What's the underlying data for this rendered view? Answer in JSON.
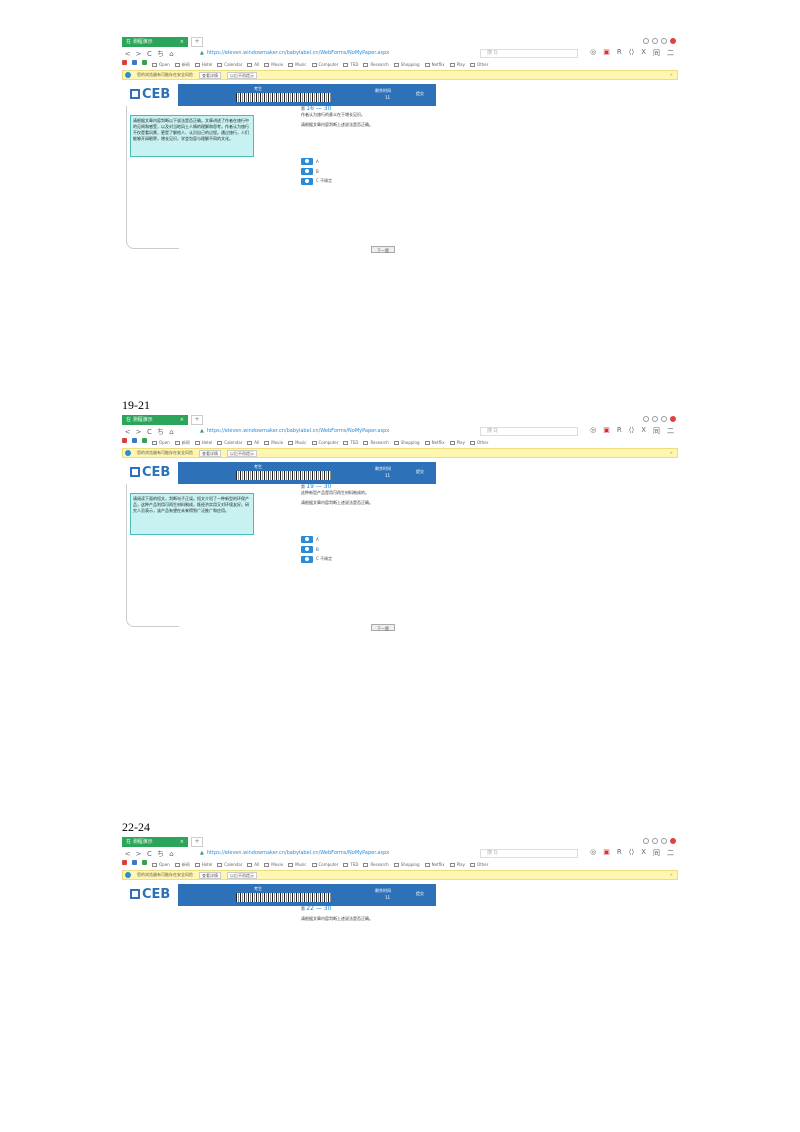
{
  "captions": [
    "19-21",
    "22-24"
  ],
  "browser": {
    "tab_title": "在 测程演示",
    "tab_close": "×",
    "tab_new": "+",
    "url": "https://eleven.windowmaker.cn/babylabel.cn/WebForms/NoMyPaper.aspx",
    "url_end": "▾",
    "search_placeholder": "搜  Q",
    "nav_buttons": [
      "<",
      ">",
      "C",
      "ち",
      "⌂"
    ],
    "nav_right": [
      "◎",
      "▣",
      "R",
      "⟨⟩",
      "X",
      "同",
      "二"
    ],
    "bookmarks": [
      "Open",
      "新闻",
      "Hotel",
      "Calendar",
      "All",
      "Movie",
      "Music",
      "Computer",
      "TED",
      "Research",
      "Shopping",
      "Netflix",
      "Play",
      "Other"
    ],
    "infobar_text": "您的浏览器有可能存在安全风险",
    "infobar_btn1": "查看详情",
    "infobar_btn2": "以后不再提示",
    "infobar_close": "×"
  },
  "exam": {
    "logo": "CEB",
    "candidate_label": "考生",
    "time_label": "剩余时间",
    "time_value": "11",
    "submit_label": "提交",
    "next_button": "下一题",
    "options": [
      "A",
      "B",
      "C 不确定"
    ]
  },
  "screens": [
    {
      "passage": "请根据文章内容判断以下说法是否正确。文章讲述了作者在旅行中的见闻和感受，以及对当地风土人情的理解和思考。作者认为旅行不仅是看风景，更是了解他人、认识自己的过程。通过旅行，人们能够开阔眼界，增长见识，学会包容与理解不同的文化。",
      "qnum_prefix": "第",
      "qnum": "16 — 30",
      "q_line1": "作者认为旅行的意义在于增长见识。",
      "q_line2": "请根据文章内容判断上述说法是否正确。"
    },
    {
      "passage": "请阅读下面的短文，判断句子正误。短文介绍了一种新型的环保产品，这种产品利用可再生材料制成，既经济实用又对环境友好。研究人员表示，该产品有望在未来得到广泛推广和应用。",
      "qnum_prefix": "第",
      "qnum": "19 — 30",
      "q_line1": "这种新型产品是用可再生材料制成的。",
      "q_line2": "请根据文章内容判断上述说法是否正确。"
    },
    {
      "passage": "",
      "qnum_prefix": "第",
      "qnum": "22 — 30",
      "q_line1": "",
      "q_line2": "请根据文章内容判断上述说法是否正确。"
    }
  ]
}
